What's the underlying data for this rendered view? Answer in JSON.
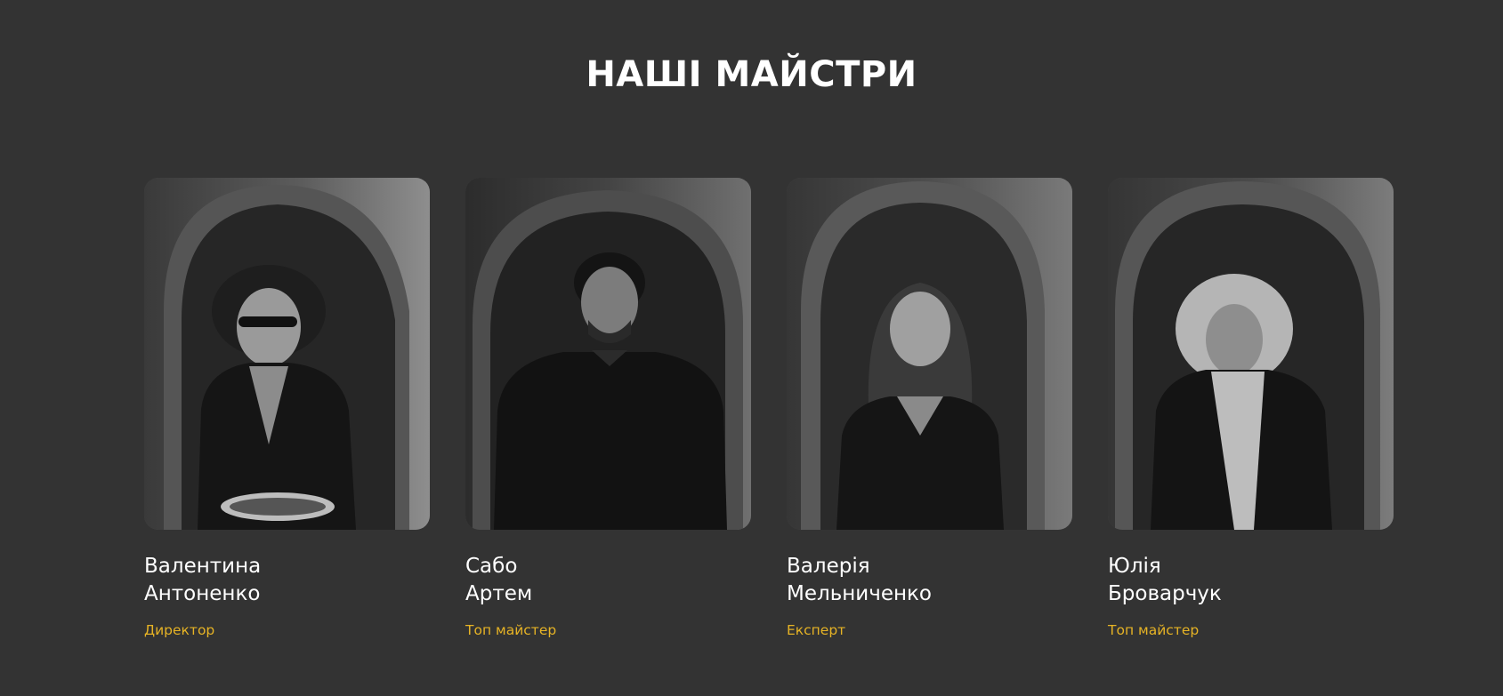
{
  "section": {
    "title": "НАШІ МАЙСТРИ"
  },
  "accent_color": "#e6b325",
  "background_color": "#333333",
  "masters": [
    {
      "first_line": "Валентина",
      "second_line": "Антоненко",
      "role": "Директор",
      "photo": "portrait-photo"
    },
    {
      "first_line": "Сабо",
      "second_line": "Артем",
      "role": "Топ майстер",
      "photo": "portrait-photo"
    },
    {
      "first_line": "Валерія",
      "second_line": "Мельниченко",
      "role": "Експерт",
      "photo": "portrait-photo"
    },
    {
      "first_line": "Юлія",
      "second_line": "Броварчук",
      "role": "Топ майстер",
      "photo": "portrait-photo"
    }
  ]
}
